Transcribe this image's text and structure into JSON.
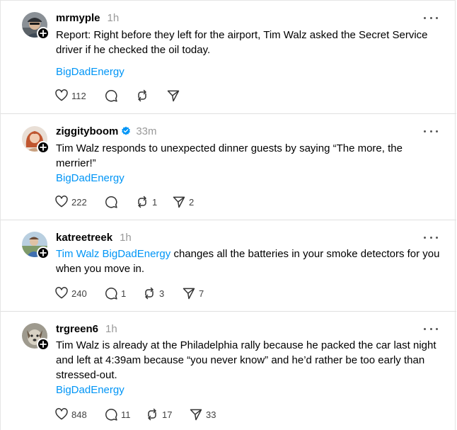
{
  "colors": {
    "link": "#0095f6",
    "verified": "#0095f6",
    "muted": "#999999",
    "divider": "#e0e0e0"
  },
  "posts": [
    {
      "username": "mrmyple",
      "verified": false,
      "time": "1h",
      "text_prefix_link": "",
      "text": "Report: Right before they left for the airport, Tim Walz asked the Secret Service driver if he checked the oil today.",
      "tag": "BigDadEnergy",
      "likes": "112",
      "replies": "",
      "reposts": "",
      "shares": "",
      "avatar_icon": "avatar-man-cap"
    },
    {
      "username": "ziggityboom",
      "verified": true,
      "time": "33m",
      "text_prefix_link": "",
      "text": "Tim Walz responds to unexpected dinner guests by saying “The more, the merrier!”",
      "tag": "BigDadEnergy",
      "likes": "222",
      "replies": "",
      "reposts": "1",
      "shares": "2",
      "avatar_icon": "avatar-woman-red-hair"
    },
    {
      "username": "katreetreek",
      "verified": false,
      "time": "1h",
      "text_prefix_link": "Tim Walz BigDadEnergy",
      "text": " changes all the batteries in your smoke detectors for you when you move in.",
      "tag": "",
      "likes": "240",
      "replies": "1",
      "reposts": "3",
      "shares": "7",
      "avatar_icon": "avatar-person-outdoors"
    },
    {
      "username": "trgreen6",
      "verified": false,
      "time": "1h",
      "text_prefix_link": "",
      "text": "Tim Walz is already at the Philadelphia rally because he packed the car last night and left at 4:39am because “you never know” and he’d rather be too early than stressed-out.",
      "tag": "BigDadEnergy",
      "likes": "848",
      "replies": "11",
      "reposts": "17",
      "shares": "33",
      "avatar_icon": "avatar-dog"
    }
  ]
}
